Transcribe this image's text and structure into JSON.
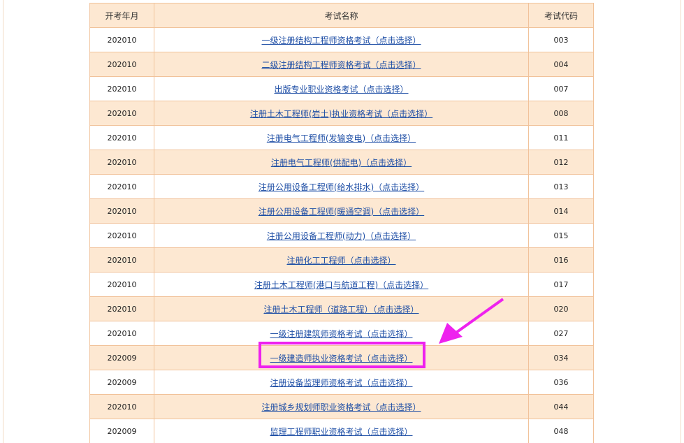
{
  "table": {
    "headers": {
      "date": "开考年月",
      "name": "考试名称",
      "code": "考试代码"
    },
    "rows": [
      {
        "date": "202010",
        "name": "一级注册结构工程师资格考试（点击选择）",
        "code": "003"
      },
      {
        "date": "202010",
        "name": "二级注册结构工程师资格考试（点击选择）",
        "code": "004"
      },
      {
        "date": "202010",
        "name": "出版专业职业资格考试（点击选择）",
        "code": "007"
      },
      {
        "date": "202010",
        "name": "注册土木工程师(岩土)执业资格考试（点击选择）",
        "code": "008"
      },
      {
        "date": "202010",
        "name": "注册电气工程师(发输变电)（点击选择）",
        "code": "011"
      },
      {
        "date": "202010",
        "name": "注册电气工程师(供配电)（点击选择）",
        "code": "012"
      },
      {
        "date": "202010",
        "name": "注册公用设备工程师(给水排水)（点击选择）",
        "code": "013"
      },
      {
        "date": "202010",
        "name": "注册公用设备工程师(暖通空调)（点击选择）",
        "code": "014"
      },
      {
        "date": "202010",
        "name": "注册公用设备工程师(动力)（点击选择）",
        "code": "015"
      },
      {
        "date": "202010",
        "name": "注册化工工程师（点击选择）",
        "code": "016"
      },
      {
        "date": "202010",
        "name": "注册土木工程师(港口与航道工程)（点击选择）",
        "code": "017"
      },
      {
        "date": "202010",
        "name": "注册土木工程师（道路工程）（点击选择）",
        "code": "020"
      },
      {
        "date": "202010",
        "name": "一级注册建筑师资格考试（点击选择）",
        "code": "027"
      },
      {
        "date": "202009",
        "name": "一级建造师执业资格考试（点击选择）",
        "code": "034"
      },
      {
        "date": "202009",
        "name": "注册设备监理师资格考试（点击选择）",
        "code": "036"
      },
      {
        "date": "202010",
        "name": "注册城乡规划师职业资格考试（点击选择）",
        "code": "044"
      },
      {
        "date": "202009",
        "name": "监理工程师职业资格考试（点击选择）",
        "code": "048"
      }
    ]
  },
  "annotation": {
    "highlight_color": "#ee22ee",
    "highlighted_code": "034"
  },
  "colors": {
    "header_bg": "#fde8d2",
    "stripe_bg": "#fde8d2",
    "border": "#f1c29a",
    "link": "#1f4fa6"
  }
}
